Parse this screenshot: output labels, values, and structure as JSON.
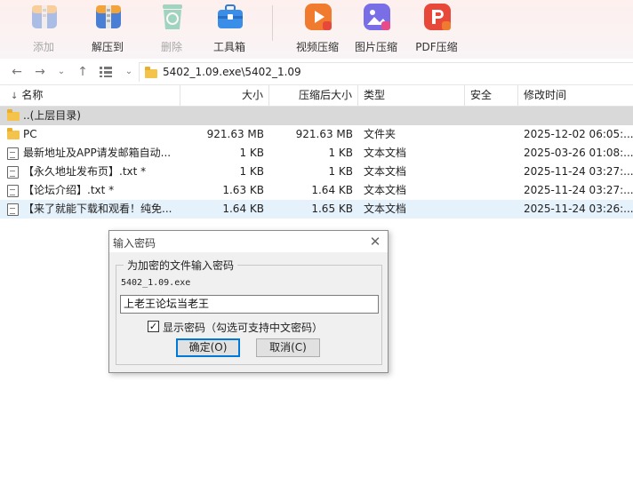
{
  "toolbar": {
    "items": [
      {
        "label": "添加",
        "icon": "add-archive-icon",
        "enabled": false,
        "color": "#4a7fd6"
      },
      {
        "label": "解压到",
        "icon": "extract-archive-icon",
        "enabled": true,
        "color": "#4a7fd6"
      },
      {
        "label": "删除",
        "icon": "recycle-bin-icon",
        "enabled": false,
        "color": "#33b38a"
      },
      {
        "label": "工具箱",
        "icon": "toolbox-icon",
        "enabled": true,
        "color": "#3a8ee8"
      },
      {
        "label": "视频压缩",
        "icon": "video-compress-icon",
        "enabled": true,
        "color": "#f07a2e"
      },
      {
        "label": "图片压缩",
        "icon": "image-compress-icon",
        "enabled": true,
        "color": "#7a6ee6"
      },
      {
        "label": "PDF压缩",
        "icon": "pdf-compress-icon",
        "enabled": true,
        "color": "#e8483a"
      }
    ]
  },
  "address": {
    "path": "5402_1.09.exe\\5402_1.09"
  },
  "columns": {
    "name": "名称",
    "size": "大小",
    "packed": "压缩后大小",
    "type": "类型",
    "security": "安全",
    "modified": "修改时间"
  },
  "files": [
    {
      "name": "..(上层目录)",
      "size": "",
      "packed": "",
      "type": "",
      "modified": "",
      "icon": "folder-icon",
      "state": "parent"
    },
    {
      "name": "PC",
      "size": "921.63 MB",
      "packed": "921.63 MB",
      "type": "文件夹",
      "modified": "2025-12-02 06:05:...",
      "icon": "folder-icon",
      "state": ""
    },
    {
      "name": "最新地址及APP请发邮箱自动...",
      "size": "1 KB",
      "packed": "1 KB",
      "type": "文本文档",
      "modified": "2025-03-26 01:08:...",
      "icon": "text-file-icon",
      "state": ""
    },
    {
      "name": "【永久地址发布页】.txt *",
      "size": "1 KB",
      "packed": "1 KB",
      "type": "文本文档",
      "modified": "2025-11-24 03:27:...",
      "icon": "text-file-icon",
      "state": ""
    },
    {
      "name": "【论坛介绍】.txt *",
      "size": "1.63 KB",
      "packed": "1.64 KB",
      "type": "文本文档",
      "modified": "2025-11-24 03:27:...",
      "icon": "text-file-icon",
      "state": ""
    },
    {
      "name": "【来了就能下载和观看！纯免...",
      "size": "1.64 KB",
      "packed": "1.65 KB",
      "type": "文本文档",
      "modified": "2025-11-24 03:26:...",
      "icon": "text-file-icon",
      "state": "selected"
    }
  ],
  "dialog": {
    "title": "输入密码",
    "group_label": "为加密的文件输入密码",
    "filename": "5402_1.09.exe",
    "password_value": "上老王论坛当老王",
    "show_password_label": "显示密码（勾选可支持中文密码）",
    "show_password_checked": true,
    "ok_label": "确定(O)",
    "cancel_label": "取消(C)"
  }
}
